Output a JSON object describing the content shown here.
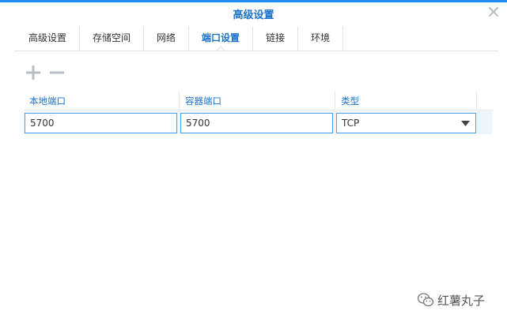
{
  "dialog": {
    "title": "高级设置"
  },
  "tabs": [
    {
      "label": "高级设置"
    },
    {
      "label": "存储空间"
    },
    {
      "label": "网络"
    },
    {
      "label": "端口设置"
    },
    {
      "label": "链接"
    },
    {
      "label": "环境"
    }
  ],
  "active_tab": "端口设置",
  "toolbar": {
    "add_icon": "plus-icon",
    "remove_icon": "minus-icon"
  },
  "table": {
    "columns": [
      "本地端口",
      "容器端口",
      "类型"
    ],
    "rows": [
      {
        "local_port": "5700",
        "container_port": "5700",
        "type": "TCP"
      }
    ]
  },
  "watermark": {
    "text": "红薯丸子",
    "icon": "wechat-icon"
  },
  "colors": {
    "accent": "#1b72c9",
    "top_bar": "#1f8ceb",
    "input_border": "#4da0ec",
    "row_highlight": "#edf4fc"
  }
}
